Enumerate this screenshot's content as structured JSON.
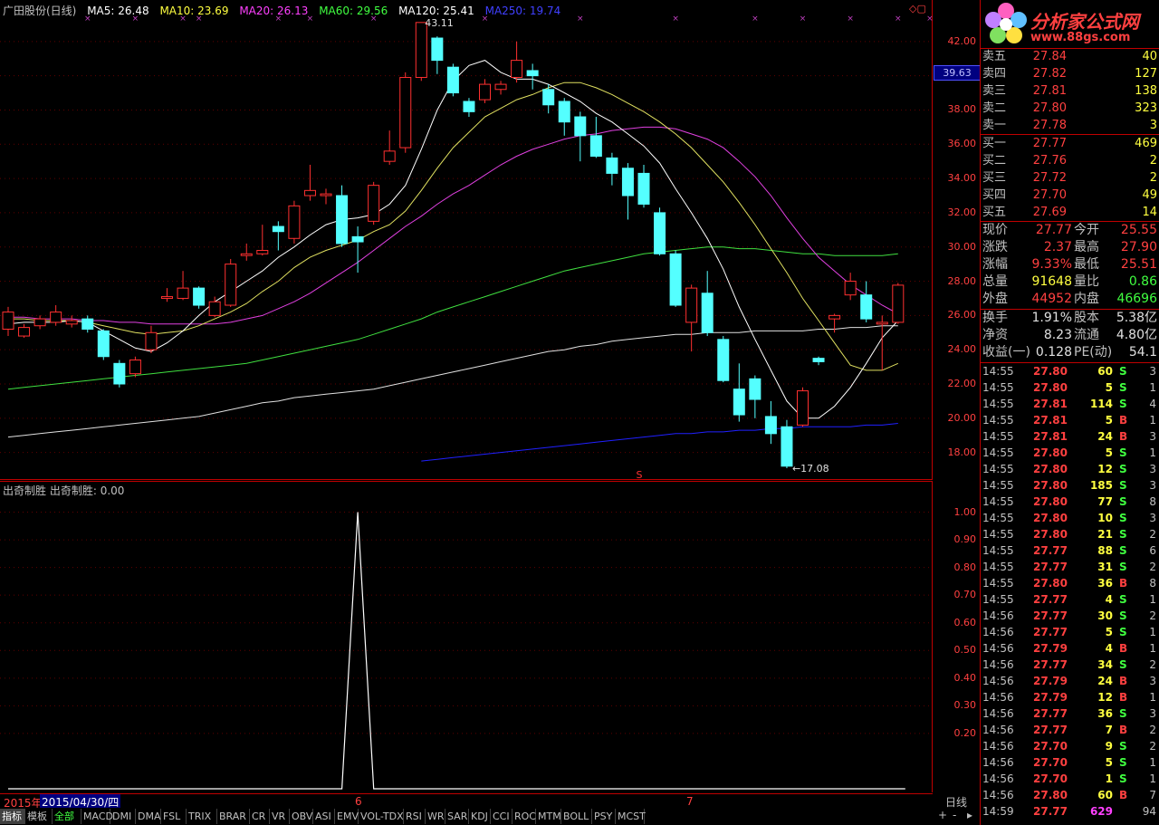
{
  "header": {
    "title": "广田股份(日线)",
    "ma5": "MA5: 26.48",
    "ma10": "MA10: 23.69",
    "ma20": "MA20: 26.13",
    "ma60": "MA60: 29.56",
    "ma120": "MA120: 25.41",
    "ma250": "MA250: 19.74",
    "colors": {
      "ma5": "#ffffff",
      "ma10": "#ffff40",
      "ma20": "#ff40ff",
      "ma60": "#40ff40",
      "ma120": "#ffffff",
      "ma250": "#4040ff"
    }
  },
  "main_chart": {
    "price_ticks": [
      "42.00",
      "40.00",
      "38.00",
      "36.00",
      "34.00",
      "32.00",
      "30.00",
      "28.00",
      "26.00",
      "24.00",
      "22.00",
      "20.00",
      "18.00"
    ],
    "current_price_marker": "39.63",
    "high_label": "43.11",
    "low_label": "17.08",
    "s_marker": "S",
    "window_icon": "diamond-box-icon"
  },
  "indicator": {
    "title": "出奇制胜",
    "value_label": "出奇制胜: 0.00",
    "ticks": [
      "1.00",
      "0.90",
      "0.80",
      "0.70",
      "0.60",
      "0.50",
      "0.40",
      "0.30",
      "0.20"
    ]
  },
  "date_bar": {
    "year_label": "2015年",
    "cursor_date": "2015/04/30/四",
    "month6": "6",
    "month7": "7",
    "period": "日线"
  },
  "chart_data": {
    "type": "candlestick",
    "ylim": [
      16.5,
      44
    ],
    "candles": [
      {
        "o": 25.2,
        "c": 26.2,
        "h": 26.5,
        "l": 24.8
      },
      {
        "o": 24.8,
        "c": 25.3,
        "h": 25.5,
        "l": 24.7
      },
      {
        "o": 25.4,
        "c": 25.8,
        "h": 26.0,
        "l": 25.2
      },
      {
        "o": 25.6,
        "c": 26.2,
        "h": 26.6,
        "l": 25.4
      },
      {
        "o": 25.5,
        "c": 25.7,
        "h": 26.0,
        "l": 25.3
      },
      {
        "o": 25.8,
        "c": 25.2,
        "h": 26.0,
        "l": 25.0
      },
      {
        "o": 25.1,
        "c": 23.6,
        "h": 25.2,
        "l": 23.4
      },
      {
        "o": 23.2,
        "c": 22.0,
        "h": 23.4,
        "l": 21.8
      },
      {
        "o": 22.6,
        "c": 23.4,
        "h": 23.6,
        "l": 22.4
      },
      {
        "o": 24.0,
        "c": 25.0,
        "h": 25.4,
        "l": 23.8
      },
      {
        "o": 27.0,
        "c": 27.1,
        "h": 27.6,
        "l": 26.8
      },
      {
        "o": 27.0,
        "c": 27.6,
        "h": 28.6,
        "l": 26.9
      },
      {
        "o": 27.6,
        "c": 26.6,
        "h": 27.7,
        "l": 26.4
      },
      {
        "o": 26.0,
        "c": 26.8,
        "h": 27.1,
        "l": 25.9
      },
      {
        "o": 26.6,
        "c": 29.0,
        "h": 29.3,
        "l": 26.5
      },
      {
        "o": 29.5,
        "c": 29.6,
        "h": 30.2,
        "l": 29.2
      },
      {
        "o": 29.6,
        "c": 29.8,
        "h": 31.3,
        "l": 29.5
      },
      {
        "o": 31.2,
        "c": 30.9,
        "h": 31.5,
        "l": 29.8
      },
      {
        "o": 30.5,
        "c": 32.4,
        "h": 32.7,
        "l": 30.2
      },
      {
        "o": 33.0,
        "c": 33.3,
        "h": 34.8,
        "l": 32.7
      },
      {
        "o": 33.0,
        "c": 33.1,
        "h": 33.4,
        "l": 32.5
      },
      {
        "o": 33.0,
        "c": 30.2,
        "h": 33.6,
        "l": 30.0
      },
      {
        "o": 30.6,
        "c": 30.3,
        "h": 31.2,
        "l": 28.5
      },
      {
        "o": 31.5,
        "c": 33.6,
        "h": 33.8,
        "l": 31.3
      },
      {
        "o": 35.0,
        "c": 35.6,
        "h": 36.8,
        "l": 34.8
      },
      {
        "o": 35.8,
        "c": 39.9,
        "h": 40.2,
        "l": 35.5
      },
      {
        "o": 39.9,
        "c": 43.11,
        "h": 43.11,
        "l": 39.7
      },
      {
        "o": 42.2,
        "c": 40.9,
        "h": 42.3,
        "l": 40.1
      },
      {
        "o": 40.5,
        "c": 39.0,
        "h": 40.7,
        "l": 38.8
      },
      {
        "o": 38.5,
        "c": 37.9,
        "h": 38.7,
        "l": 37.6
      },
      {
        "o": 38.6,
        "c": 39.5,
        "h": 39.8,
        "l": 38.4
      },
      {
        "o": 39.2,
        "c": 39.5,
        "h": 39.7,
        "l": 38.9
      },
      {
        "o": 39.9,
        "c": 40.9,
        "h": 42.0,
        "l": 39.6
      },
      {
        "o": 40.3,
        "c": 40.0,
        "h": 40.7,
        "l": 39.2
      },
      {
        "o": 39.2,
        "c": 38.3,
        "h": 39.5,
        "l": 37.8
      },
      {
        "o": 38.5,
        "c": 37.3,
        "h": 38.7,
        "l": 36.5
      },
      {
        "o": 37.6,
        "c": 36.5,
        "h": 37.9,
        "l": 35.0
      },
      {
        "o": 36.5,
        "c": 35.3,
        "h": 37.6,
        "l": 35.2
      },
      {
        "o": 35.2,
        "c": 34.3,
        "h": 35.5,
        "l": 33.6
      },
      {
        "o": 34.6,
        "c": 33.0,
        "h": 34.9,
        "l": 31.6
      },
      {
        "o": 34.3,
        "c": 32.5,
        "h": 34.8,
        "l": 32.3
      },
      {
        "o": 32.0,
        "c": 29.6,
        "h": 32.3,
        "l": 29.5
      },
      {
        "o": 29.6,
        "c": 26.6,
        "h": 29.8,
        "l": 26.5
      },
      {
        "o": 25.6,
        "c": 27.6,
        "h": 27.8,
        "l": 23.9
      },
      {
        "o": 27.3,
        "c": 25.0,
        "h": 28.6,
        "l": 24.8
      },
      {
        "o": 24.6,
        "c": 22.2,
        "h": 24.8,
        "l": 22.1
      },
      {
        "o": 21.7,
        "c": 20.2,
        "h": 23.2,
        "l": 19.8
      },
      {
        "o": 22.3,
        "c": 21.1,
        "h": 22.5,
        "l": 20.0
      },
      {
        "o": 20.1,
        "c": 19.1,
        "h": 21.0,
        "l": 18.5
      },
      {
        "o": 19.5,
        "c": 17.2,
        "h": 19.9,
        "l": 17.08
      },
      {
        "o": 19.6,
        "c": 21.6,
        "h": 21.8,
        "l": 19.5
      },
      {
        "o": 23.5,
        "c": 23.3,
        "h": 23.6,
        "l": 23.1
      },
      {
        "o": 25.8,
        "c": 26.0,
        "h": 26.1,
        "l": 25.0
      },
      {
        "o": 27.2,
        "c": 28.0,
        "h": 28.5,
        "l": 26.9
      },
      {
        "o": 27.2,
        "c": 25.8,
        "h": 28.0,
        "l": 25.6
      },
      {
        "o": 25.5,
        "c": 25.6,
        "h": 26.0,
        "l": 22.8
      },
      {
        "o": 25.6,
        "c": 27.77,
        "h": 27.9,
        "l": 25.51
      }
    ],
    "ma5": [
      25.5,
      25.6,
      25.6,
      25.6,
      25.7,
      25.6,
      25.1,
      24.6,
      24.1,
      23.9,
      24.4,
      25.1,
      26.0,
      26.8,
      27.4,
      28.0,
      28.6,
      29.4,
      30.0,
      30.7,
      31.3,
      31.6,
      31.7,
      31.9,
      32.5,
      33.6,
      35.7,
      38.0,
      39.7,
      40.6,
      40.9,
      40.2,
      39.8,
      39.8,
      39.5,
      39.0,
      38.5,
      37.8,
      37.3,
      36.6,
      35.9,
      34.9,
      33.4,
      32.0,
      30.5,
      28.7,
      26.5,
      24.6,
      22.8,
      21.0,
      20.0,
      20.0,
      20.7,
      21.8,
      23.2,
      24.7,
      25.7
    ],
    "ma10": [
      25.8,
      25.8,
      25.7,
      25.7,
      25.7,
      25.6,
      25.4,
      25.2,
      25.0,
      24.9,
      25.0,
      25.1,
      25.4,
      25.8,
      26.2,
      26.7,
      27.4,
      28.0,
      28.8,
      29.4,
      29.8,
      30.1,
      30.4,
      30.9,
      31.3,
      32.1,
      33.3,
      34.6,
      35.8,
      36.7,
      37.6,
      38.1,
      38.6,
      38.9,
      39.3,
      39.6,
      39.6,
      39.3,
      38.9,
      38.4,
      37.9,
      37.3,
      36.6,
      35.8,
      34.8,
      33.8,
      32.6,
      31.3,
      29.9,
      28.5,
      27.0,
      25.7,
      24.4,
      23.1,
      22.8,
      22.8,
      23.2
    ],
    "ma20": [
      25.9,
      25.9,
      25.8,
      25.8,
      25.8,
      25.7,
      25.7,
      25.6,
      25.6,
      25.5,
      25.5,
      25.5,
      25.5,
      25.5,
      25.6,
      25.8,
      26.0,
      26.4,
      26.8,
      27.3,
      27.9,
      28.5,
      29.1,
      29.8,
      30.5,
      31.2,
      31.8,
      32.5,
      33.1,
      33.6,
      34.2,
      34.8,
      35.3,
      35.7,
      36.0,
      36.3,
      36.5,
      36.6,
      36.8,
      36.9,
      37.0,
      37.0,
      36.9,
      36.6,
      36.3,
      35.8,
      35.0,
      34.1,
      33.0,
      31.7,
      30.5,
      29.4,
      28.6,
      27.8,
      27.2,
      26.6,
      26.1
    ],
    "ma60": [
      21.7,
      21.8,
      21.9,
      22.0,
      22.1,
      22.2,
      22.3,
      22.4,
      22.5,
      22.6,
      22.7,
      22.8,
      22.9,
      23.0,
      23.1,
      23.2,
      23.4,
      23.6,
      23.8,
      24.0,
      24.2,
      24.4,
      24.6,
      24.9,
      25.2,
      25.5,
      25.8,
      26.2,
      26.5,
      26.8,
      27.1,
      27.4,
      27.7,
      28.0,
      28.3,
      28.6,
      28.8,
      29.0,
      29.2,
      29.4,
      29.6,
      29.7,
      29.8,
      29.9,
      30.0,
      30.0,
      29.9,
      29.9,
      29.8,
      29.7,
      29.6,
      29.6,
      29.5,
      29.5,
      29.5,
      29.5,
      29.6
    ],
    "ma120": [
      18.9,
      19.0,
      19.1,
      19.2,
      19.3,
      19.4,
      19.5,
      19.6,
      19.7,
      19.8,
      19.9,
      20.0,
      20.1,
      20.3,
      20.5,
      20.7,
      20.9,
      21.0,
      21.2,
      21.3,
      21.4,
      21.5,
      21.6,
      21.7,
      21.9,
      22.1,
      22.3,
      22.5,
      22.7,
      22.9,
      23.1,
      23.3,
      23.5,
      23.7,
      23.9,
      24.0,
      24.2,
      24.3,
      24.5,
      24.6,
      24.7,
      24.8,
      24.9,
      24.9,
      25.0,
      25.0,
      25.0,
      25.1,
      25.1,
      25.1,
      25.1,
      25.2,
      25.2,
      25.3,
      25.3,
      25.4,
      25.4
    ],
    "ma250_start_index": 26,
    "ma250": [
      17.5,
      17.6,
      17.7,
      17.8,
      17.9,
      18.0,
      18.1,
      18.2,
      18.3,
      18.4,
      18.5,
      18.6,
      18.7,
      18.8,
      18.9,
      19.0,
      19.1,
      19.1,
      19.2,
      19.2,
      19.3,
      19.3,
      19.4,
      19.4,
      19.5,
      19.5,
      19.5,
      19.5,
      19.6,
      19.6,
      19.7
    ],
    "indicator_series": [
      0,
      0,
      0,
      0,
      0,
      0,
      0,
      0,
      0,
      0,
      0,
      0,
      0,
      0,
      0,
      0,
      0,
      0,
      0,
      0,
      0,
      0,
      1,
      0,
      0,
      0,
      0,
      0,
      0,
      0,
      0,
      0,
      0,
      0,
      0,
      0,
      0,
      0,
      0,
      0,
      0,
      0,
      0,
      0,
      0,
      0,
      0,
      0,
      0,
      0,
      0,
      0,
      0,
      0,
      0,
      0,
      0
    ],
    "indicator_ylim": [
      0,
      1.1
    ]
  },
  "order_book": {
    "sell": [
      {
        "label": "卖五",
        "price": "27.84",
        "vol": "40"
      },
      {
        "label": "卖四",
        "price": "27.82",
        "vol": "127"
      },
      {
        "label": "卖三",
        "price": "27.81",
        "vol": "138"
      },
      {
        "label": "卖二",
        "price": "27.80",
        "vol": "323"
      },
      {
        "label": "卖一",
        "price": "27.78",
        "vol": "3"
      }
    ],
    "buy": [
      {
        "label": "买一",
        "price": "27.77",
        "vol": "469"
      },
      {
        "label": "买二",
        "price": "27.76",
        "vol": "2"
      },
      {
        "label": "买三",
        "price": "27.72",
        "vol": "2"
      },
      {
        "label": "买四",
        "price": "27.70",
        "vol": "49"
      },
      {
        "label": "买五",
        "price": "27.69",
        "vol": "14"
      }
    ]
  },
  "stats": [
    {
      "l1": "现价",
      "v1": "27.77",
      "c1": "red",
      "l2": "今开",
      "v2": "25.55",
      "c2": "red"
    },
    {
      "l1": "涨跌",
      "v1": "2.37",
      "c1": "red",
      "l2": "最高",
      "v2": "27.90",
      "c2": "red"
    },
    {
      "l1": "涨幅",
      "v1": "9.33%",
      "c1": "red",
      "l2": "最低",
      "v2": "25.51",
      "c2": "red"
    },
    {
      "l1": "总量",
      "v1": "91648",
      "c1": "yel",
      "l2": "量比",
      "v2": "0.86",
      "c2": "green"
    },
    {
      "l1": "外盘",
      "v1": "44952",
      "c1": "red",
      "l2": "内盘",
      "v2": "46696",
      "c2": "green"
    }
  ],
  "stats2": [
    {
      "l1": "换手",
      "v1": "1.91%",
      "l2": "股本",
      "v2": "5.38亿"
    },
    {
      "l1": "净资",
      "v1": "8.23",
      "l2": "流通",
      "v2": "4.80亿"
    },
    {
      "l1": "收益(一)",
      "v1": "0.128",
      "l2": "PE(动)",
      "v2": "54.1"
    }
  ],
  "ticks": [
    {
      "t": "14:55",
      "p": "27.80",
      "pc": "red",
      "v": "60",
      "vc": "yel",
      "s": "S",
      "n": "3"
    },
    {
      "t": "14:55",
      "p": "27.80",
      "pc": "red",
      "v": "5",
      "vc": "yel",
      "s": "S",
      "n": "1"
    },
    {
      "t": "14:55",
      "p": "27.81",
      "pc": "red",
      "v": "114",
      "vc": "yel",
      "s": "S",
      "n": "4"
    },
    {
      "t": "14:55",
      "p": "27.81",
      "pc": "red",
      "v": "5",
      "vc": "yel",
      "s": "B",
      "n": "1"
    },
    {
      "t": "14:55",
      "p": "27.81",
      "pc": "red",
      "v": "24",
      "vc": "yel",
      "s": "B",
      "n": "3"
    },
    {
      "t": "14:55",
      "p": "27.80",
      "pc": "red",
      "v": "5",
      "vc": "yel",
      "s": "S",
      "n": "1"
    },
    {
      "t": "14:55",
      "p": "27.80",
      "pc": "red",
      "v": "12",
      "vc": "yel",
      "s": "S",
      "n": "3"
    },
    {
      "t": "14:55",
      "p": "27.80",
      "pc": "red",
      "v": "185",
      "vc": "yel",
      "s": "S",
      "n": "3"
    },
    {
      "t": "14:55",
      "p": "27.80",
      "pc": "red",
      "v": "77",
      "vc": "yel",
      "s": "S",
      "n": "8"
    },
    {
      "t": "14:55",
      "p": "27.80",
      "pc": "red",
      "v": "10",
      "vc": "yel",
      "s": "S",
      "n": "3"
    },
    {
      "t": "14:55",
      "p": "27.80",
      "pc": "red",
      "v": "21",
      "vc": "yel",
      "s": "S",
      "n": "2"
    },
    {
      "t": "14:55",
      "p": "27.77",
      "pc": "red",
      "v": "88",
      "vc": "yel",
      "s": "S",
      "n": "6"
    },
    {
      "t": "14:55",
      "p": "27.77",
      "pc": "red",
      "v": "31",
      "vc": "yel",
      "s": "S",
      "n": "2"
    },
    {
      "t": "14:55",
      "p": "27.80",
      "pc": "red",
      "v": "36",
      "vc": "yel",
      "s": "B",
      "n": "8"
    },
    {
      "t": "14:55",
      "p": "27.77",
      "pc": "red",
      "v": "4",
      "vc": "yel",
      "s": "S",
      "n": "1"
    },
    {
      "t": "14:56",
      "p": "27.77",
      "pc": "red",
      "v": "30",
      "vc": "yel",
      "s": "S",
      "n": "2"
    },
    {
      "t": "14:56",
      "p": "27.77",
      "pc": "red",
      "v": "5",
      "vc": "yel",
      "s": "S",
      "n": "1"
    },
    {
      "t": "14:56",
      "p": "27.79",
      "pc": "red",
      "v": "4",
      "vc": "yel",
      "s": "B",
      "n": "1"
    },
    {
      "t": "14:56",
      "p": "27.77",
      "pc": "red",
      "v": "34",
      "vc": "yel",
      "s": "S",
      "n": "2"
    },
    {
      "t": "14:56",
      "p": "27.79",
      "pc": "red",
      "v": "24",
      "vc": "yel",
      "s": "B",
      "n": "3"
    },
    {
      "t": "14:56",
      "p": "27.79",
      "pc": "red",
      "v": "12",
      "vc": "yel",
      "s": "B",
      "n": "1"
    },
    {
      "t": "14:56",
      "p": "27.77",
      "pc": "red",
      "v": "36",
      "vc": "yel",
      "s": "S",
      "n": "3"
    },
    {
      "t": "14:56",
      "p": "27.77",
      "pc": "red",
      "v": "7",
      "vc": "yel",
      "s": "B",
      "n": "2"
    },
    {
      "t": "14:56",
      "p": "27.70",
      "pc": "red",
      "v": "9",
      "vc": "yel",
      "s": "S",
      "n": "2"
    },
    {
      "t": "14:56",
      "p": "27.70",
      "pc": "red",
      "v": "5",
      "vc": "yel",
      "s": "S",
      "n": "1"
    },
    {
      "t": "14:56",
      "p": "27.70",
      "pc": "red",
      "v": "1",
      "vc": "yel",
      "s": "S",
      "n": "1"
    },
    {
      "t": "14:56",
      "p": "27.80",
      "pc": "red",
      "v": "60",
      "vc": "yel",
      "s": "B",
      "n": "7"
    },
    {
      "t": "14:59",
      "p": "27.77",
      "pc": "red",
      "v": "629",
      "vc": "mag",
      "s": "",
      "n": "94"
    }
  ],
  "logo": {
    "text": "分析家公式网",
    "url": "www.88gs.com"
  },
  "tabs": [
    "指标",
    "模板",
    "全部",
    "MACD",
    "DMI",
    "DMA",
    "FSL",
    "TRIX",
    "BRAR",
    "CR",
    "VR",
    "OBV",
    "ASI",
    "EMV",
    "VOL-TDX",
    "RSI",
    "WR",
    "SAR",
    "KDJ",
    "CCI",
    "ROC",
    "MTM",
    "BOLL",
    "PSY",
    "MCST"
  ],
  "scroll": {
    "plus": "+",
    "minus": "-",
    "arrow": "▸"
  }
}
